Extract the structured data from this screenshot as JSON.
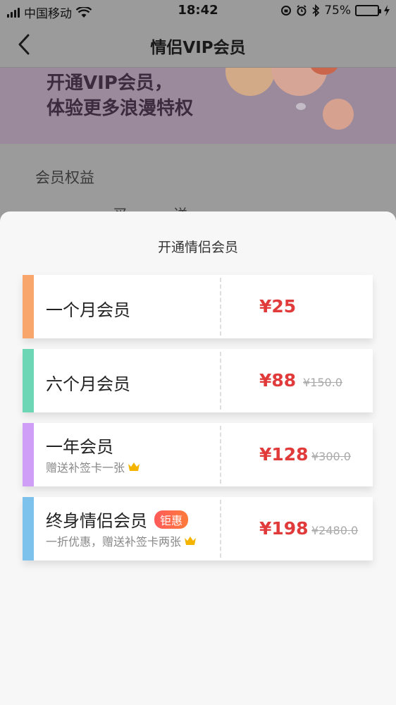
{
  "status_bar": {
    "carrier": "中国移动",
    "time": "18:42",
    "battery_percent": "75%",
    "battery_level": 0.75,
    "icons": [
      "signal-icon",
      "wifi-icon",
      "lock-rotation-icon",
      "alarm-icon",
      "bluetooth-icon",
      "battery-icon",
      "charging-icon"
    ]
  },
  "nav": {
    "title": "情侣VIP会员",
    "back_icon": "chevron-left-icon"
  },
  "banner": {
    "line1": "开通VIP会员，",
    "line2": "体验更多浪漫特权"
  },
  "section": {
    "title": "会员权益",
    "peek_text": "买 送"
  },
  "sheet": {
    "title": "开通情侣会员",
    "plans": [
      {
        "name": "一个月会员",
        "subtitle": "",
        "badge": "",
        "price": "¥25",
        "original": "",
        "color": "#f9a66c"
      },
      {
        "name": "六个月会员",
        "subtitle": "",
        "badge": "",
        "price": "¥88",
        "original": "¥150.0",
        "color": "#6dd6b4"
      },
      {
        "name": "一年会员",
        "subtitle": "赠送补签卡一张",
        "badge": "",
        "price": "¥128",
        "original": "¥300.0",
        "color": "#cf9ff7"
      },
      {
        "name": "终身情侣会员",
        "subtitle": "一折优惠，赠送补签卡两张",
        "badge": "钜惠",
        "price": "¥198",
        "original": "¥2480.0",
        "color": "#7cc2ec"
      }
    ]
  },
  "colors": {
    "price": "#e03a3a",
    "overlay": "#9b9b9b",
    "crown": "#f5b400"
  }
}
